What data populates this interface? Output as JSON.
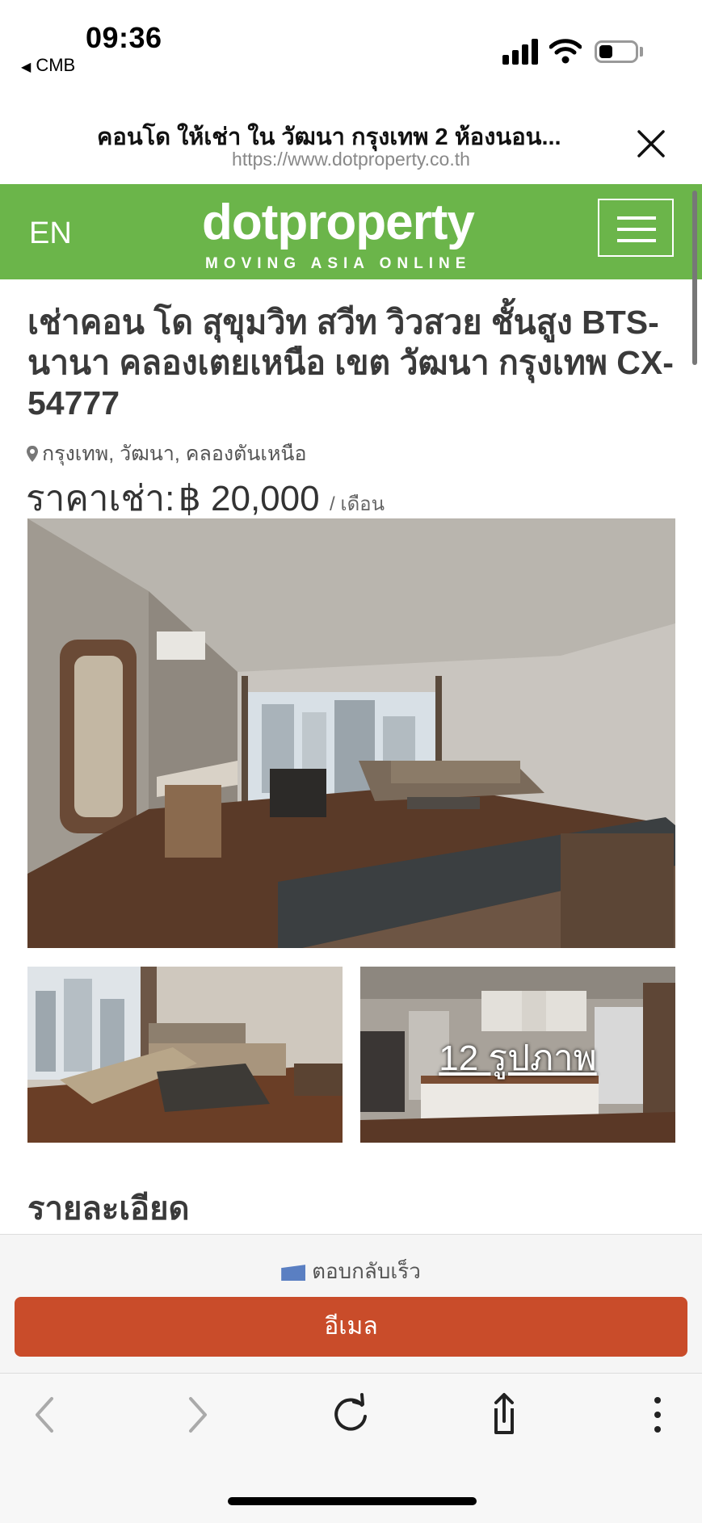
{
  "status_bar": {
    "time": "09:36",
    "back_app": "CMB"
  },
  "browser": {
    "page_title": "คอนโด ให้เช่า ใน วัฒนา กรุงเทพ 2 ห้องนอน...",
    "url": "https://www.dotproperty.co.th"
  },
  "site_header": {
    "language": "EN",
    "logo_text": "dotproperty",
    "logo_tagline": "MOVING ASIA ONLINE",
    "brand_color": "#6bb54a"
  },
  "listing": {
    "title": "เช่าคอน โด สุขุมวิท สวีท วิวสวย ชั้นสูง BTS-นานา คลองเตยเหนือ เขต วัฒนา กรุงเทพ CX-54777",
    "location": "กรุงเทพ, วัฒนา, คลองตันเหนือ",
    "price_label": "ราคาเช่า:",
    "price_value": "฿ 20,000",
    "price_unit": "/ เดือน",
    "photo_count_label": "12 รูปภาพ",
    "details_heading": "รายละเอียด"
  },
  "contact": {
    "quick_reply": "ตอบกลับเร็ว",
    "email_button": "อีเมล",
    "email_button_color": "#c94c2a"
  },
  "icons": [
    "location-pin-icon",
    "close-icon",
    "hamburger-menu-icon",
    "back-arrow-icon",
    "forward-arrow-icon",
    "reload-icon",
    "share-icon",
    "more-icon",
    "envelope-icon",
    "signal-icon",
    "wifi-icon",
    "battery-icon"
  ]
}
